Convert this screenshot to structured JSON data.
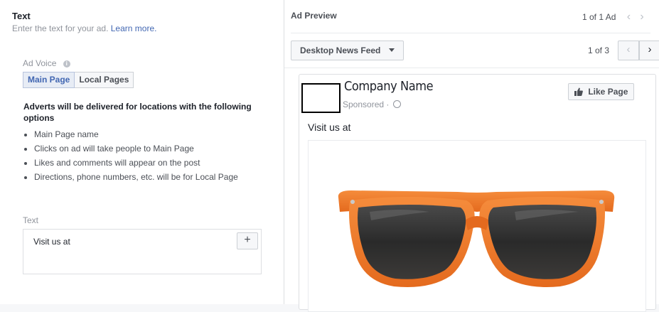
{
  "left": {
    "title": "Text",
    "subtitle": "Enter the text for your ad.",
    "learn_more": "Learn more.",
    "ad_voice_label": "Ad Voice",
    "ad_voice_options": [
      "Main Page",
      "Local Pages"
    ],
    "ad_voice_selected": "Main Page",
    "delivery_note": "Adverts will be delivered for locations with the following options",
    "bullets": [
      "Main Page name",
      "Clicks on ad will take people to Main Page",
      "Likes and comments will appear on the post",
      "Directions, phone numbers, etc. will be for Local Page"
    ],
    "text_label": "Text",
    "text_value": "Visit us at",
    "add_symbol": "+"
  },
  "right": {
    "title": "Ad Preview",
    "ad_count": "1 of 1 Ad",
    "placement": "Desktop News Feed",
    "pager": "1 of 3",
    "card": {
      "company_name": "Company Name",
      "sponsored": "Sponsored ·",
      "like_button": "Like Page",
      "post_text": "Visit us at"
    }
  },
  "colors": {
    "accent": "#4267b2",
    "frame_orange": "#f07a2c",
    "lens": "#2b2b2b"
  },
  "icons": [
    "info-icon",
    "plus-icon",
    "chevron-left-icon",
    "chevron-right-icon",
    "caret-down-icon",
    "globe-icon",
    "thumbs-up-icon"
  ]
}
